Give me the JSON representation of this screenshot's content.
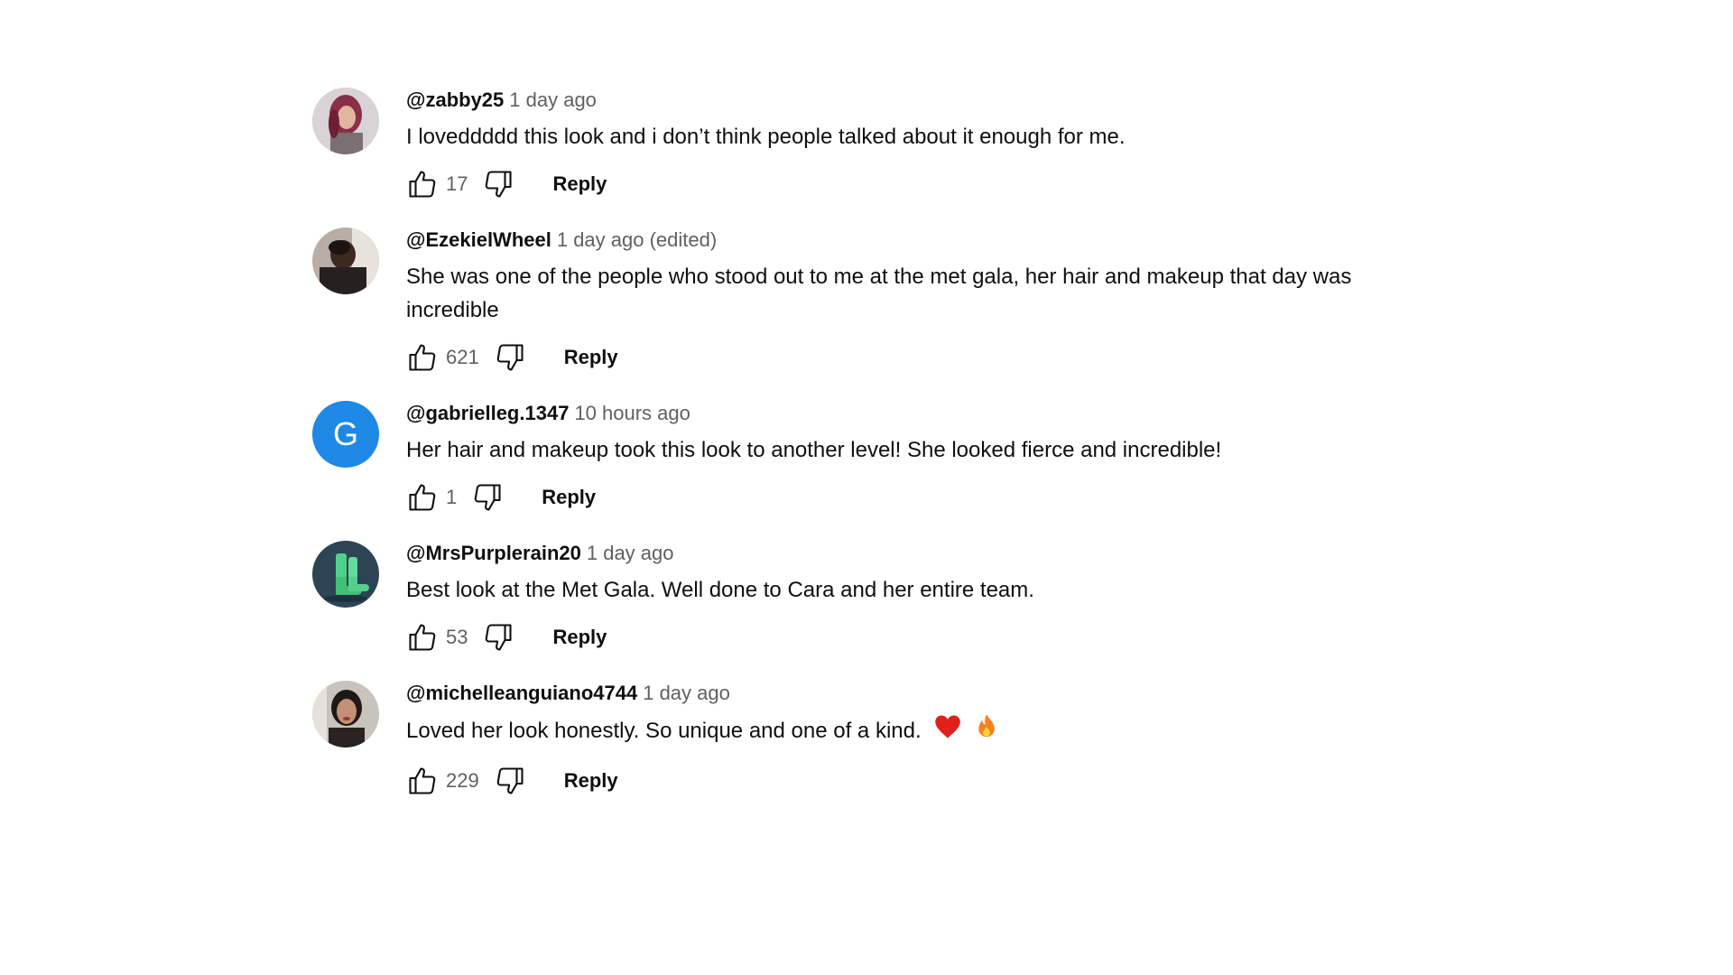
{
  "comments": [
    {
      "author": "@zabby25",
      "time": "1 day ago",
      "text": "I loveddddd this look and i don’t think people talked about it enough for me.",
      "likes": "17",
      "reply_label": "Reply",
      "avatar": "photo-woman-pink-hair"
    },
    {
      "author": "@EzekielWheel",
      "time": "1 day ago (edited)",
      "text": "She was one of the people who stood out to me at the met gala, her hair and makeup that day was incredible",
      "likes": "621",
      "reply_label": "Reply",
      "avatar": "photo-man-dark"
    },
    {
      "author": "@gabrielleg.1347",
      "time": "10 hours ago",
      "text": "Her hair and makeup took this look to another level! She looked fierce and incredible!",
      "likes": "1",
      "reply_label": "Reply",
      "avatar_letter": "G",
      "avatar_color": "#1e88e5"
    },
    {
      "author": "@MrsPurplerain20",
      "time": "1 day ago",
      "text": "Best look at the Met Gala. Well done to Cara and her entire team.",
      "likes": "53",
      "reply_label": "Reply",
      "avatar": "green-boots"
    },
    {
      "author": "@michelleanguiano4744",
      "time": "1 day ago",
      "text": "Loved her look honestly. So unique and one of a kind.",
      "emojis": [
        "heart-emoji",
        "fire-emoji"
      ],
      "likes": "229",
      "reply_label": "Reply",
      "avatar": "photo-woman-portrait"
    }
  ],
  "icons": {
    "like": "thumbs-up-icon",
    "dislike": "thumbs-down-icon"
  },
  "colors": {
    "text_primary": "#0f0f0f",
    "text_secondary": "#606060",
    "letter_avatar_bg": "#1e88e5",
    "heart": "#e0201b",
    "fire": "#f5821f"
  }
}
